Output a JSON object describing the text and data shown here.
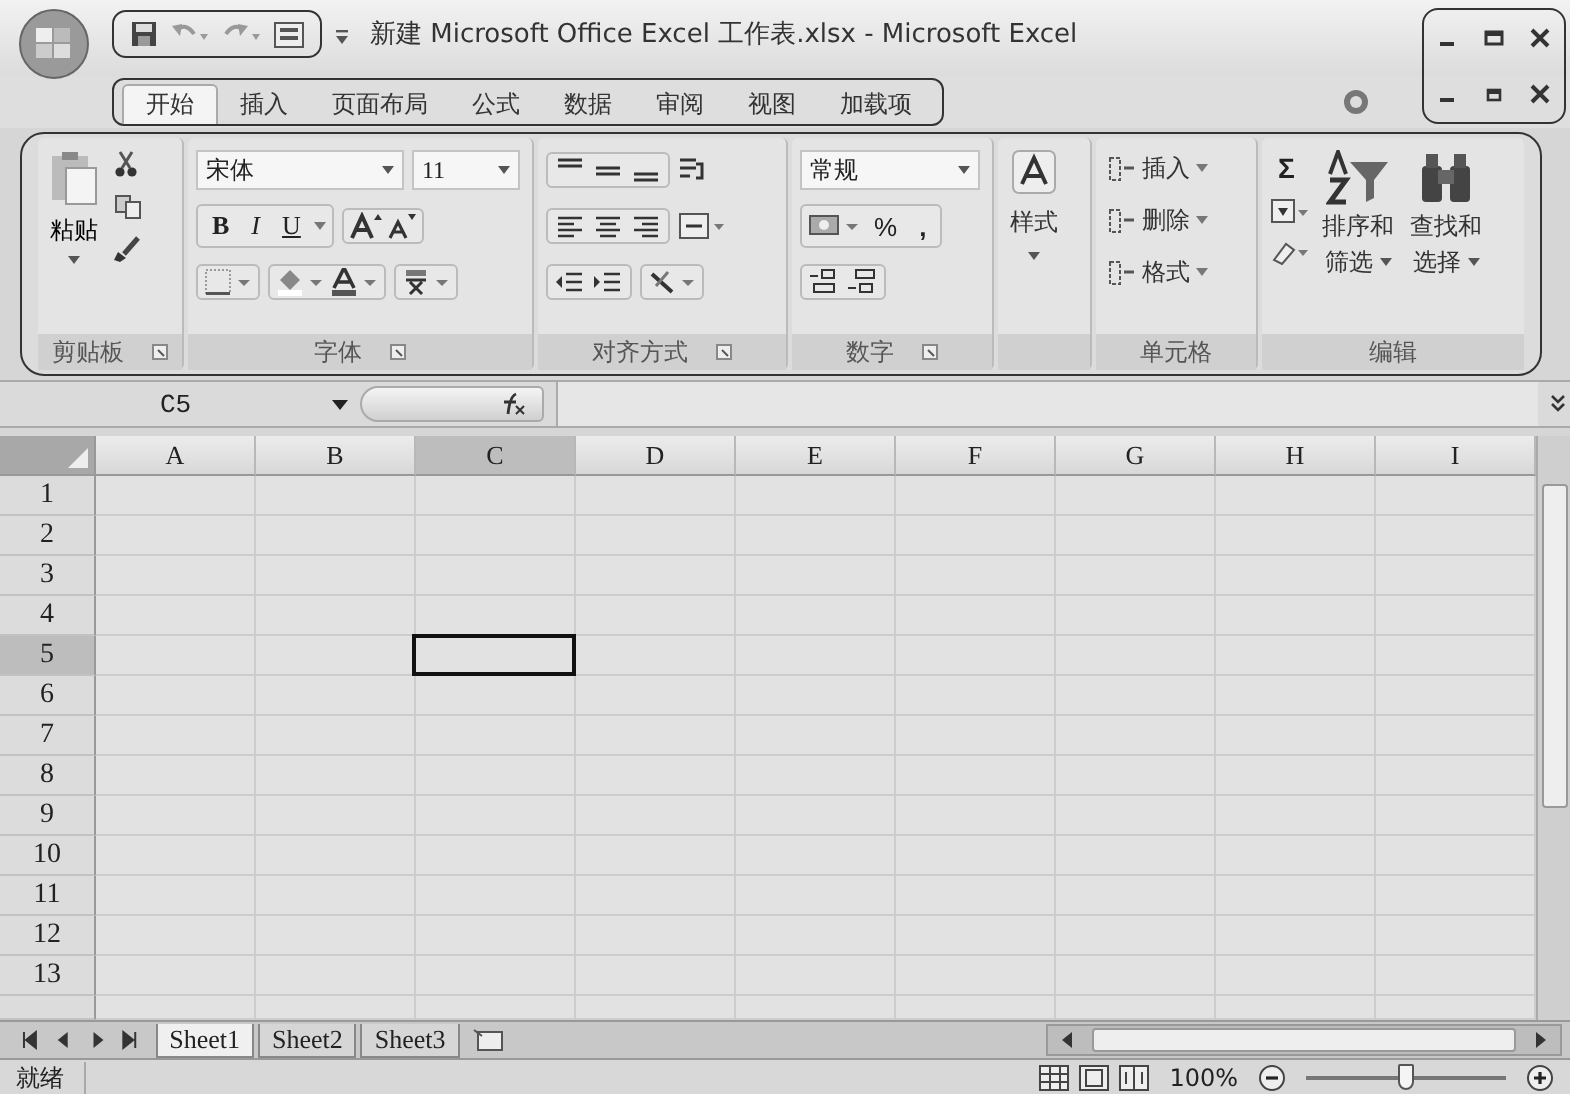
{
  "window": {
    "title": "新建 Microsoft Office Excel 工作表.xlsx - Microsoft Excel"
  },
  "tabs": [
    {
      "label": "开始",
      "selected": true
    },
    {
      "label": "插入",
      "selected": false
    },
    {
      "label": "页面布局",
      "selected": false
    },
    {
      "label": "公式",
      "selected": false
    },
    {
      "label": "数据",
      "selected": false
    },
    {
      "label": "审阅",
      "selected": false
    },
    {
      "label": "视图",
      "selected": false
    },
    {
      "label": "加载项",
      "selected": false
    }
  ],
  "ribbon": {
    "clipboard": {
      "paste": "粘贴",
      "label": "剪贴板"
    },
    "font": {
      "name": "宋体",
      "size": "11",
      "bold": "B",
      "italic": "I",
      "underline": "U",
      "label": "字体"
    },
    "alignment": {
      "label": "对齐方式"
    },
    "number": {
      "format": "常规",
      "percent": "%",
      "comma": ",",
      "label": "数字"
    },
    "styles": {
      "button": "样式"
    },
    "cells": {
      "items": [
        "插入",
        "删除",
        "格式"
      ],
      "label": "单元格"
    },
    "editing": {
      "sum": "Σ",
      "sort": [
        "排序和",
        "筛选"
      ],
      "find": [
        "查找和",
        "选择"
      ],
      "label": "编辑"
    }
  },
  "formula_bar": {
    "name_box": "C5"
  },
  "sheet": {
    "columns": [
      {
        "label": "A",
        "selected": false
      },
      {
        "label": "B",
        "selected": false
      },
      {
        "label": "C",
        "selected": true
      },
      {
        "label": "D",
        "selected": false
      },
      {
        "label": "E",
        "selected": false
      },
      {
        "label": "F",
        "selected": false
      },
      {
        "label": "G",
        "selected": false
      },
      {
        "label": "H",
        "selected": false
      },
      {
        "label": "I",
        "selected": false
      }
    ],
    "rows": [
      {
        "label": "1",
        "selected": false
      },
      {
        "label": "2",
        "selected": false
      },
      {
        "label": "3",
        "selected": false
      },
      {
        "label": "4",
        "selected": false
      },
      {
        "label": "5",
        "selected": true
      },
      {
        "label": "6",
        "selected": false
      },
      {
        "label": "7",
        "selected": false
      },
      {
        "label": "8",
        "selected": false
      },
      {
        "label": "9",
        "selected": false
      },
      {
        "label": "10",
        "selected": false
      },
      {
        "label": "11",
        "selected": false
      },
      {
        "label": "12",
        "selected": false
      },
      {
        "label": "13",
        "selected": false
      }
    ]
  },
  "sheet_tabs": [
    {
      "label": "Sheet1",
      "selected": true
    },
    {
      "label": "Sheet2",
      "selected": false
    },
    {
      "label": "Sheet3",
      "selected": false
    }
  ],
  "status_bar": {
    "status": "就绪",
    "zoom": "100%",
    "zoom_slider": {
      "level": 0.5
    }
  }
}
